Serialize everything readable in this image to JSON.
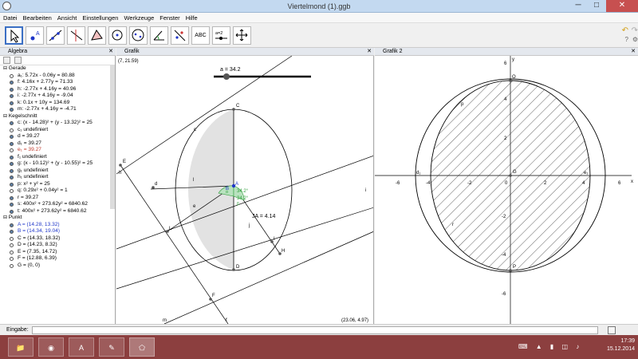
{
  "window": {
    "title": "Viertelmond (1).ggb",
    "minimize": "─",
    "maximize": "□",
    "close": "✕"
  },
  "menu": [
    "Datei",
    "Bearbeiten",
    "Ansicht",
    "Einstellungen",
    "Werkzeuge",
    "Fenster",
    "Hilfe"
  ],
  "toolbar": {
    "text_tool": "ABC",
    "slider_tool": "a=2"
  },
  "panels": {
    "algebra": "Algebra",
    "grafik": "Grafik",
    "grafik2": "Grafik 2",
    "close": "✕"
  },
  "algebra": {
    "categories": {
      "gerade": "Gerade",
      "kegelschnitt": "Kegelschnitt",
      "punkt": "Punkt"
    },
    "gerade": [
      "a₁: 5.72x - 0.06y = 80.88",
      "f: 4.16x + 2.77y = 71.33",
      "h: -2.77x + 4.16y = 40.96",
      "i: -2.77x + 4.16y = -9.04",
      "k: 0.1x + 10y = 134.69",
      "m: -2.77x + 4.16y = -4.71"
    ],
    "kegelschnitt": [
      "c: (x - 14.28)² + (y - 13.32)² = 25",
      "c₁ undefiniert",
      "d = 39.27",
      "d₁ = 39.27",
      "e₁ = 39.27",
      "f₁ undefiniert",
      "g: (x - 10.12)² + (y - 10.55)² = 25",
      "g₁ undefiniert",
      "h₁ undefiniert",
      "p: x² + y² = 25",
      "q: 0.29x² + 0.04y² = 1",
      "r = 39.27",
      "s: 400x² + 273.62y² = 6840.62",
      "t: 400x² + 273.62y² = 6840.62"
    ],
    "punkt": [
      "A = (14.28, 13.32)",
      "B = (14.34, 19.04)",
      "C = (14.33, 18.32)",
      "D = (14.23, 8.32)",
      "E = (7.35, 14.72)",
      "F = (12.88, 6.39)",
      "G = (0, 0)"
    ]
  },
  "grafik": {
    "corner_tl": "(7, 21.59)",
    "corner_br": "(23.06, 4.97)",
    "slider": "a = 34.2",
    "angle1": "34.2°",
    "angle2": "34.2°",
    "ja": "JA = 4.14",
    "labels": {
      "C": "C",
      "D": "D",
      "A": "A",
      "B": "B",
      "E": "E",
      "F": "F",
      "I": "I",
      "H": "H",
      "L": "L",
      "J": "J",
      "c": "c",
      "d": "d",
      "e": "e",
      "l": "l",
      "h": "h",
      "i": "i",
      "j": "j",
      "f": "f",
      "m": "m",
      "alpha": "α",
      "beta": "β"
    }
  },
  "grafik2": {
    "x_ticks": [
      "-6",
      "-4",
      "-2",
      "0",
      "2",
      "4",
      "6"
    ],
    "y_ticks": [
      "6",
      "4",
      "2",
      "-2",
      "-4",
      "-6"
    ],
    "labels": {
      "O": "O",
      "G": "G",
      "d1": "d₁",
      "e1": "e₁",
      "p": "p",
      "r": "r",
      "P": "P",
      "axis_x": "x",
      "axis_y": "y"
    }
  },
  "inputbar": {
    "label": "Eingabe:"
  },
  "taskbar": {
    "time": "17:39",
    "date": "15.12.2014"
  },
  "colors": {
    "taskbar": "#8c3f3f",
    "circle_fill": "#e2e2e2",
    "angle": "#2e9e3a",
    "point": "#1f36c9"
  }
}
